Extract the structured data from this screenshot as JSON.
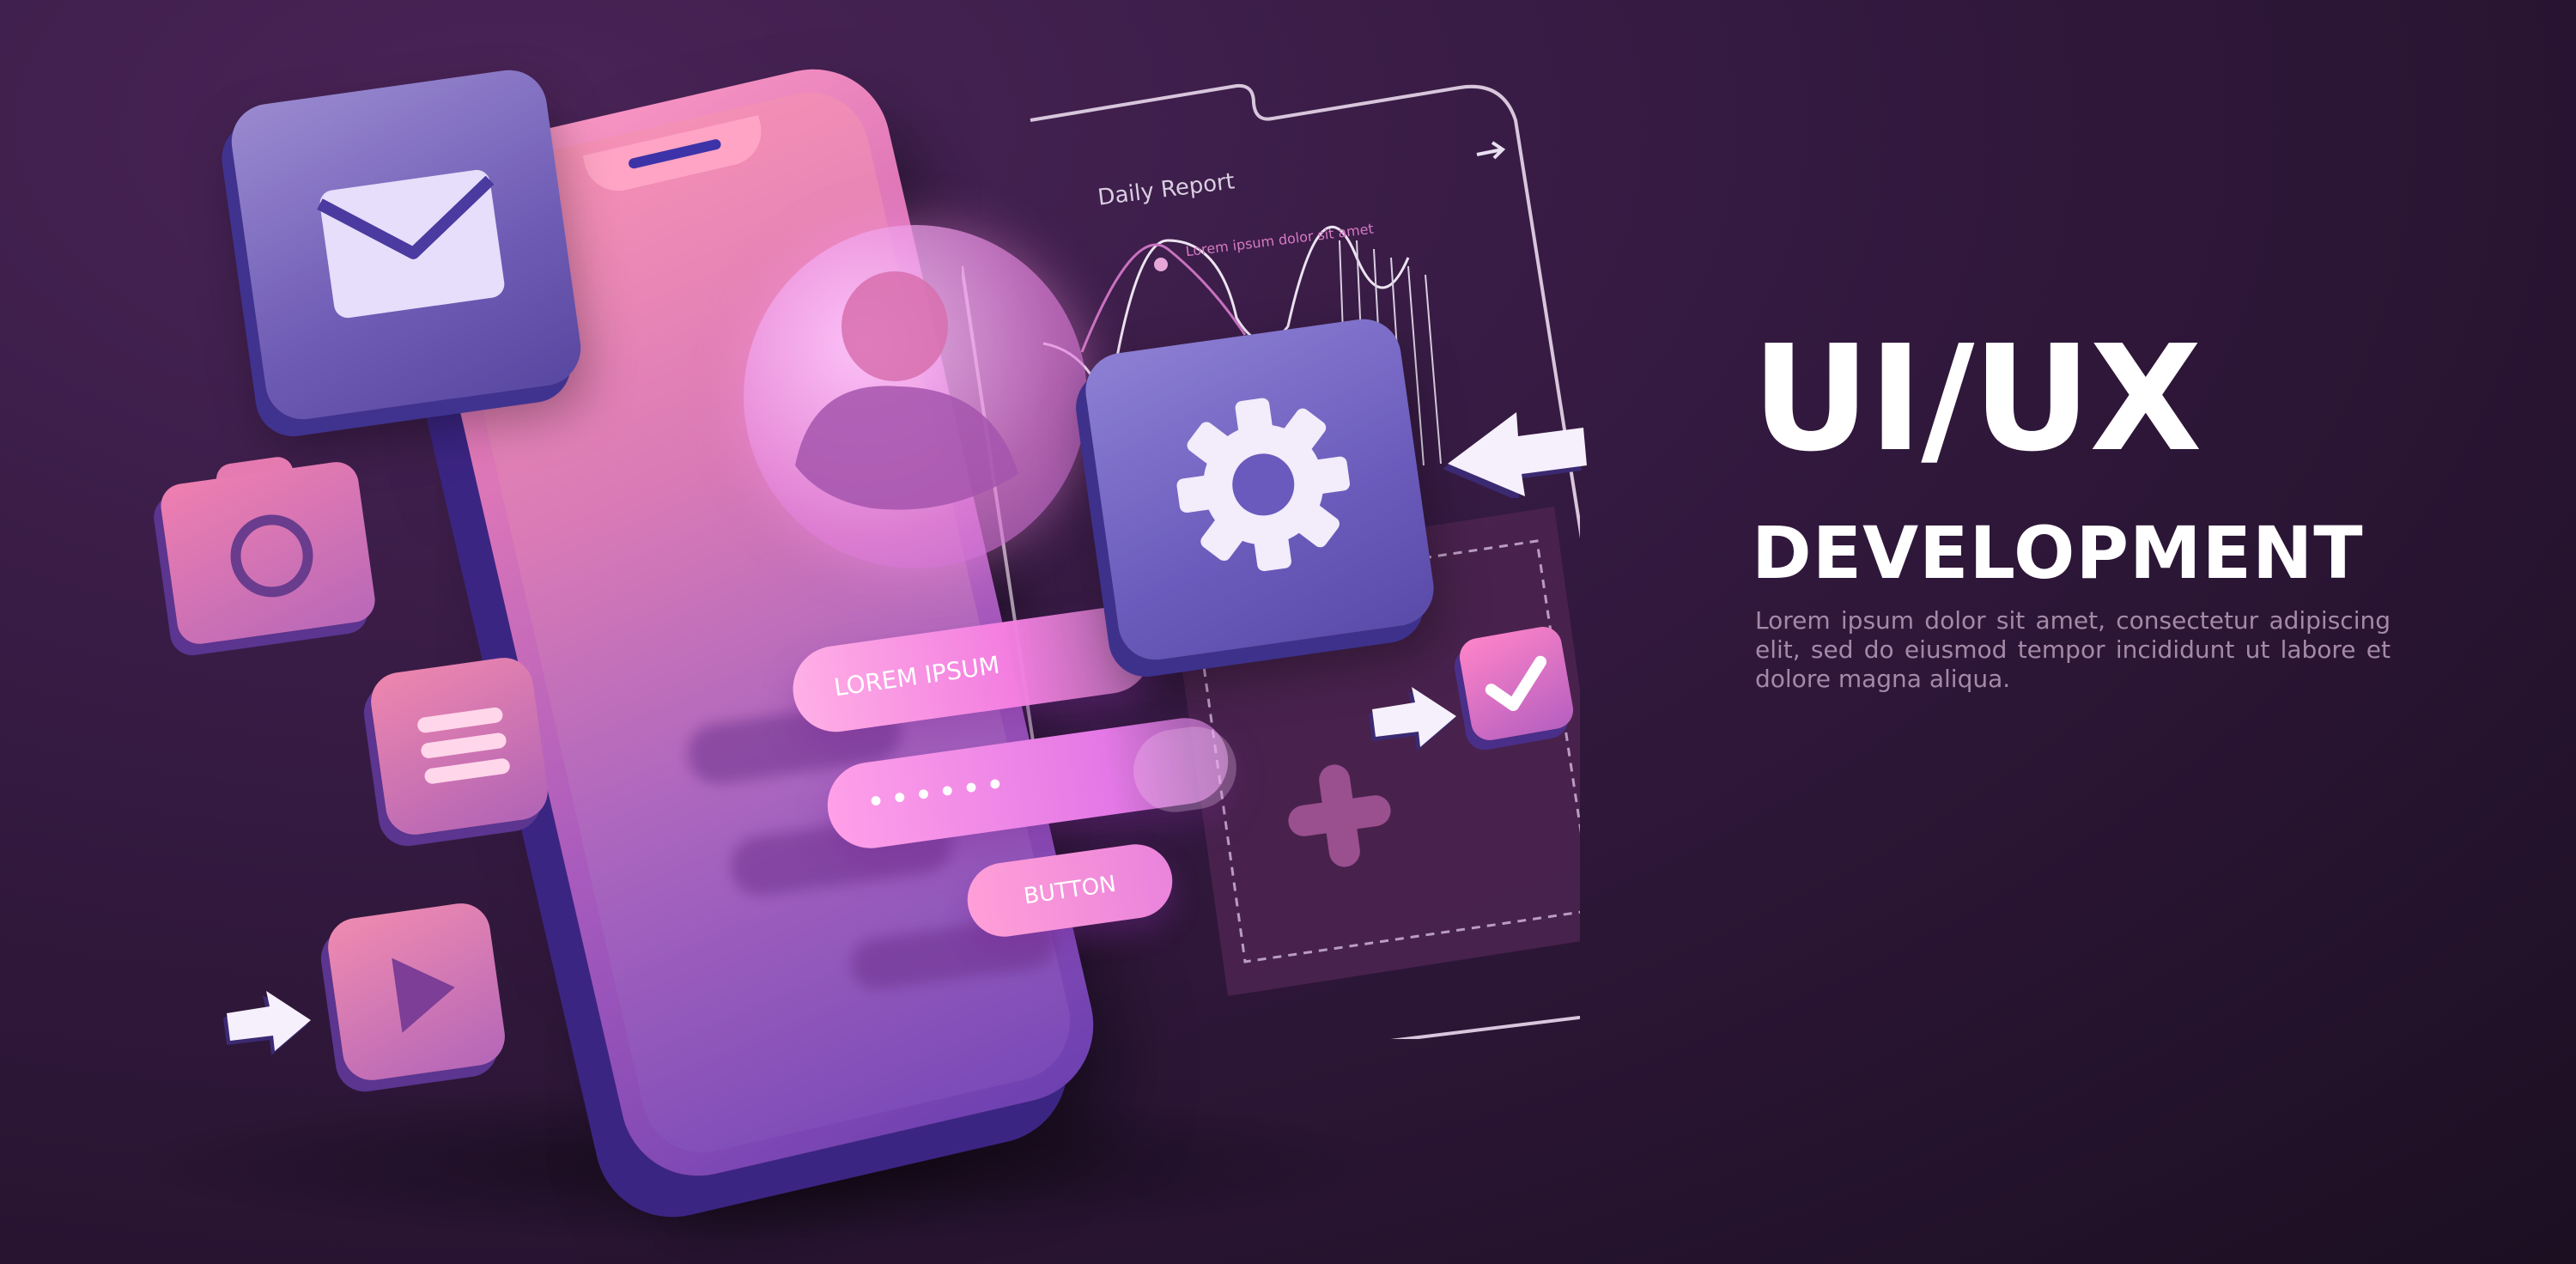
{
  "headline": {
    "line1": "UI/UX",
    "line2": "DEVELOPMENT",
    "description": "Lorem ipsum dolor sit amet, consectetur adipiscing elit, sed do eiusmod tempor incididunt ut labore et dolore magna aliqua."
  },
  "phone": {
    "input_label": "LOREM IPSUM",
    "password_mask": "••••••",
    "button_label": "BUTTON"
  },
  "report": {
    "title": "Daily Report",
    "note": "Lorem ipsum dolor sit amet"
  },
  "icons": [
    "envelope-icon",
    "gear-icon",
    "camera-icon",
    "list-icon",
    "play-icon",
    "check-icon",
    "plus-icon",
    "arrow-icon",
    "user-icon"
  ],
  "colors": {
    "background": "#33193f",
    "phone_pink": "#f892b5",
    "phone_purple": "#7a4ab7",
    "tile_violet": "#6f5cb5",
    "text_white": "#ffffff",
    "text_muted": "#a48aa8"
  }
}
